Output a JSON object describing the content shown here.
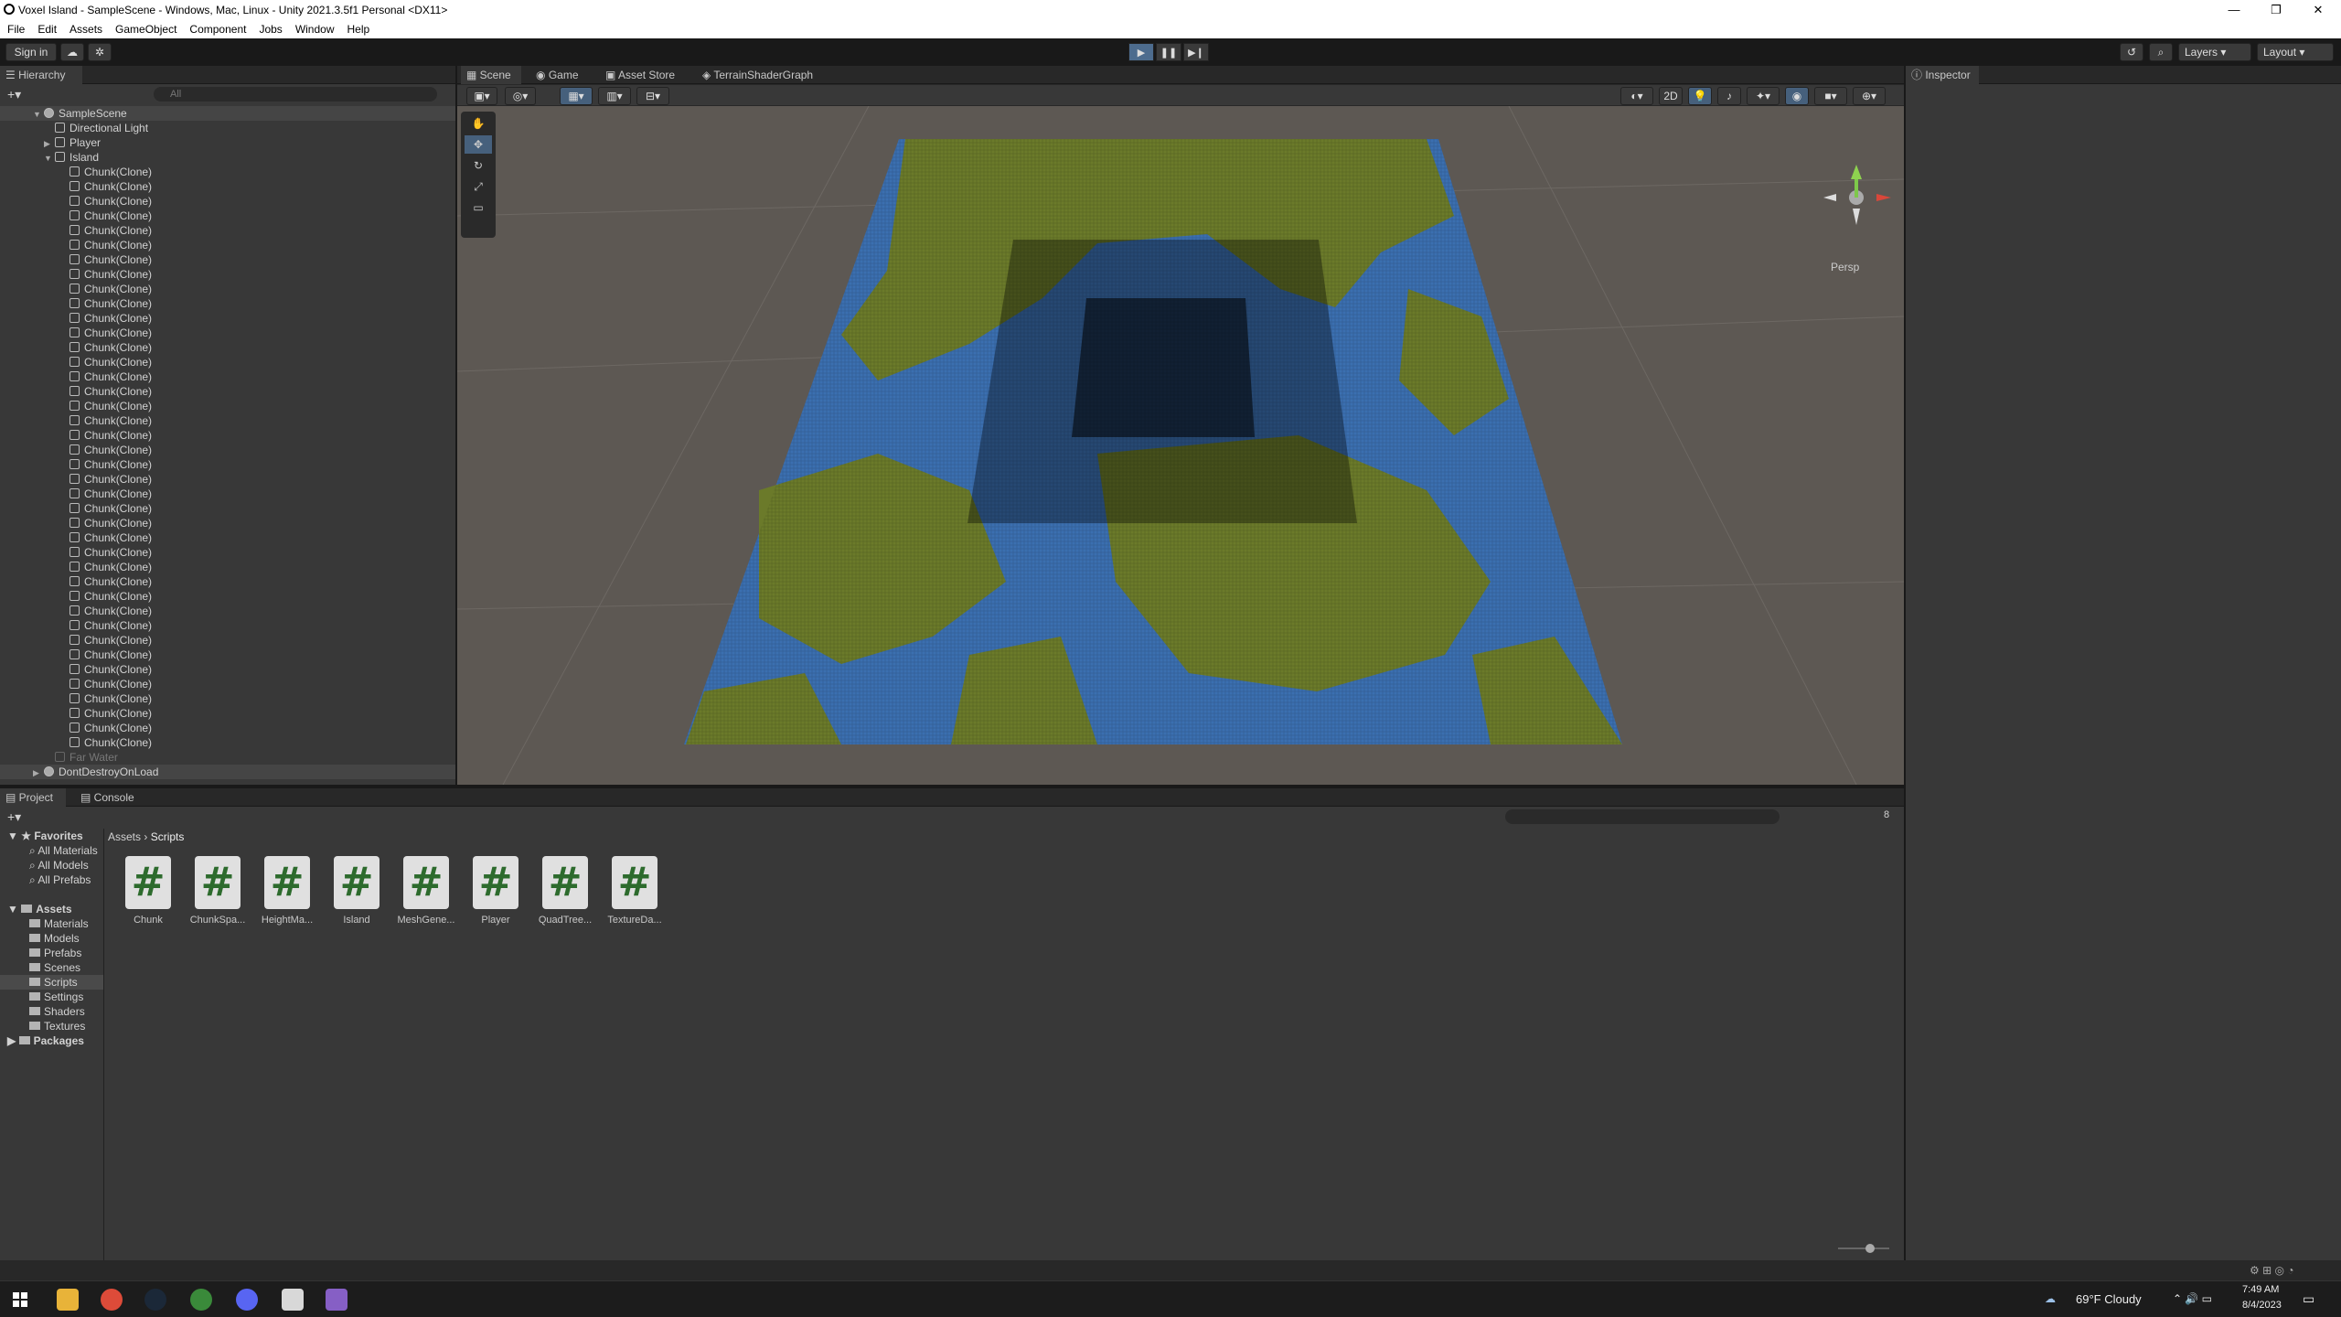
{
  "window": {
    "title": "Voxel Island - SampleScene - Windows, Mac, Linux - Unity 2021.3.5f1 Personal <DX11>"
  },
  "menu": [
    "File",
    "Edit",
    "Assets",
    "GameObject",
    "Component",
    "Jobs",
    "Window",
    "Help"
  ],
  "toolbar": {
    "sign_in": "Sign in",
    "layers": "Layers",
    "layout": "Layout"
  },
  "hierarchy": {
    "title": "Hierarchy",
    "search_placeholder": "All",
    "scene": "SampleScene",
    "items": [
      "Directional Light",
      "Player",
      "Island"
    ],
    "chunk_label": "Chunk(Clone)",
    "chunk_count": 40,
    "far_water": "Far Water",
    "dont_destroy": "DontDestroyOnLoad"
  },
  "scene_tabs": [
    "Scene",
    "Game",
    "Asset Store",
    "TerrainShaderGraph"
  ],
  "scene_view": {
    "mode_2d": "2D",
    "persp": "Persp"
  },
  "inspector": {
    "title": "Inspector"
  },
  "project": {
    "tabs": [
      "Project",
      "Console"
    ],
    "favorites": {
      "label": "Favorites",
      "items": [
        "All Materials",
        "All Models",
        "All Prefabs"
      ]
    },
    "assets": {
      "label": "Assets",
      "items": [
        "Materials",
        "Models",
        "Prefabs",
        "Scenes",
        "Scripts",
        "Settings",
        "Shaders",
        "Textures"
      ]
    },
    "packages": "Packages",
    "breadcrumb": [
      "Assets",
      "Scripts"
    ],
    "scripts": [
      "Chunk",
      "ChunkSpa...",
      "HeightMa...",
      "Island",
      "MeshGene...",
      "Player",
      "QuadTree...",
      "TextureDa..."
    ],
    "hidden_count": "8"
  },
  "taskbar": {
    "weather": "69°F  Cloudy",
    "time": "7:49 AM",
    "date": "8/4/2023"
  },
  "colors": {
    "water": "#3b6fb0",
    "grass": "#6b7a2a",
    "selection": "#2c5d87"
  }
}
